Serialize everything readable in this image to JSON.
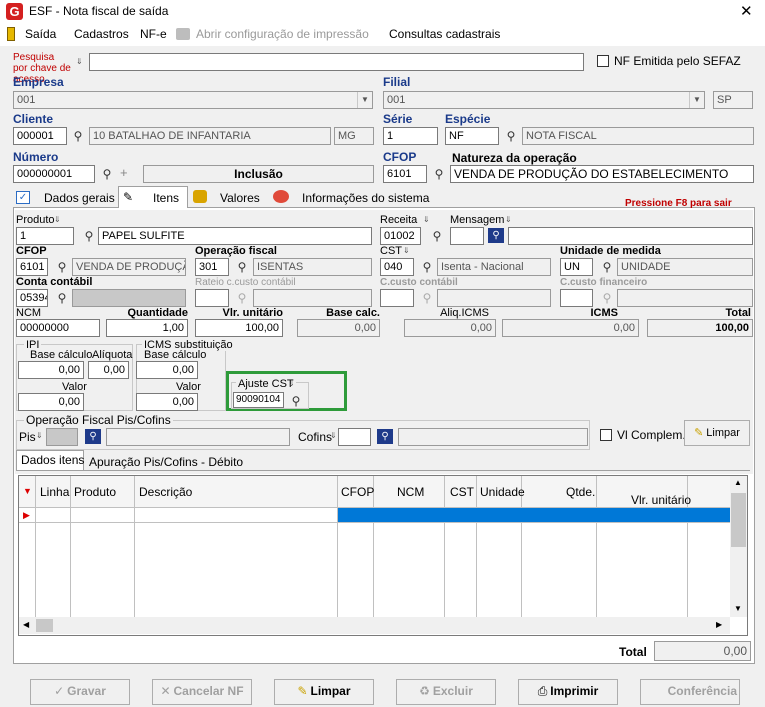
{
  "window": {
    "title": "ESF - Nota fiscal de saída",
    "close": "✕"
  },
  "menu": {
    "saida": "Saída",
    "cadastros": "Cadastros",
    "nfe": "NF-e",
    "abrir_impressao": "Abrir configuração de impressão",
    "consultas": "Consultas cadastrais"
  },
  "search": {
    "label": "Pesquisa por chave de acesso",
    "value": "",
    "nf_sefaz_label": "NF Emitida pelo SEFAZ"
  },
  "empresa": {
    "label": "Empresa",
    "value": "001"
  },
  "filial": {
    "label": "Filial",
    "value": "001",
    "uf": "SP"
  },
  "cliente": {
    "label": "Cliente",
    "code": "000001",
    "name": "10 BATALHAO DE INFANTARIA",
    "uf": "MG"
  },
  "serie": {
    "label": "Série",
    "value": "1"
  },
  "especie": {
    "label": "Espécie",
    "code": "NF",
    "name": "NOTA FISCAL"
  },
  "numero": {
    "label": "Número",
    "value": "000000001",
    "mode": "Inclusão"
  },
  "cfop_header": {
    "label": "CFOP",
    "value": "6101"
  },
  "natureza": {
    "label": "Natureza da operação",
    "value": "VENDA DE PRODUÇÃO DO ESTABELECIMENTO"
  },
  "tabs": {
    "dados_gerais": "Dados gerais",
    "itens": "Itens",
    "valores": "Valores",
    "info_sistema": "Informações do sistema",
    "hint": "Pressione F8 para sair"
  },
  "item": {
    "produto_label": "Produto",
    "produto_code": "1",
    "produto_name": "PAPEL SULFITE",
    "receita_label": "Receita",
    "receita_value": "01002",
    "mensagem_label": "Mensagem",
    "mensagem_value": "",
    "cfop_label": "CFOP",
    "cfop_code": "6101",
    "cfop_name": "VENDA DE PRODUÇÃO D",
    "opfiscal_label": "Operação fiscal",
    "opfiscal_code": "301",
    "opfiscal_name": "ISENTAS",
    "cst_label": "CST",
    "cst_code": "040",
    "cst_name": "Isenta - Nacional",
    "unidade_label": "Unidade de medida",
    "unidade_code": "UN",
    "unidade_name": "UNIDADE",
    "conta_label": "Conta contábil",
    "conta_code": "05394",
    "rateio_label": "Rateio c.custo contábil",
    "ccusto_contabil_label": "C.custo contábil",
    "ccusto_fin_label": "C.custo financeiro",
    "ncm_label": "NCM",
    "ncm_value": "00000000",
    "qtd_label": "Quantidade",
    "qtd_value": "1,00",
    "vunit_label": "Vlr. unitário",
    "vunit_value": "100,00",
    "basecalc_label": "Base calc.",
    "basecalc_value": "0,00",
    "aliq_label": "Aliq.ICMS",
    "aliq_value": "0,00",
    "icms_label": "ICMS",
    "icms_value": "0,00",
    "total_label": "Total",
    "total_value": "100,00"
  },
  "ipi": {
    "title": "IPI",
    "base_label": "Base cálculo",
    "base_value": "0,00",
    "aliq_label": "Alíquota",
    "aliq_value": "0,00",
    "valor_label": "Valor",
    "valor_value": "0,00"
  },
  "icms_st": {
    "title": "ICMS substituição",
    "base_label": "Base cálculo",
    "base_value": "0,00",
    "valor_label": "Valor",
    "valor_value": "0,00"
  },
  "ajuste": {
    "label": "Ajuste CST",
    "value": "90090104"
  },
  "piscofins": {
    "title": "Operação Fiscal Pis/Cofins",
    "pis_label": "Pis",
    "cofins_label": "Cofins",
    "vl_complem": "Vl Complem.",
    "limpar": "Limpar"
  },
  "subtabs": {
    "dados_itens": "Dados itens",
    "apuracao": "Apuração Pis/Cofins - Débito"
  },
  "grid": {
    "columns": [
      "Linha",
      "Produto",
      "Descrição",
      "CFOP",
      "NCM",
      "CST",
      "Unidade",
      "Qtde.",
      "Vlr. unitário"
    ],
    "total_label": "Total",
    "total_value": "0,00"
  },
  "buttons": {
    "gravar": "Gravar",
    "cancelar": "Cancelar NF",
    "limpar": "Limpar",
    "excluir": "Excluir",
    "imprimir": "Imprimir",
    "conferencia": "Conferência"
  }
}
